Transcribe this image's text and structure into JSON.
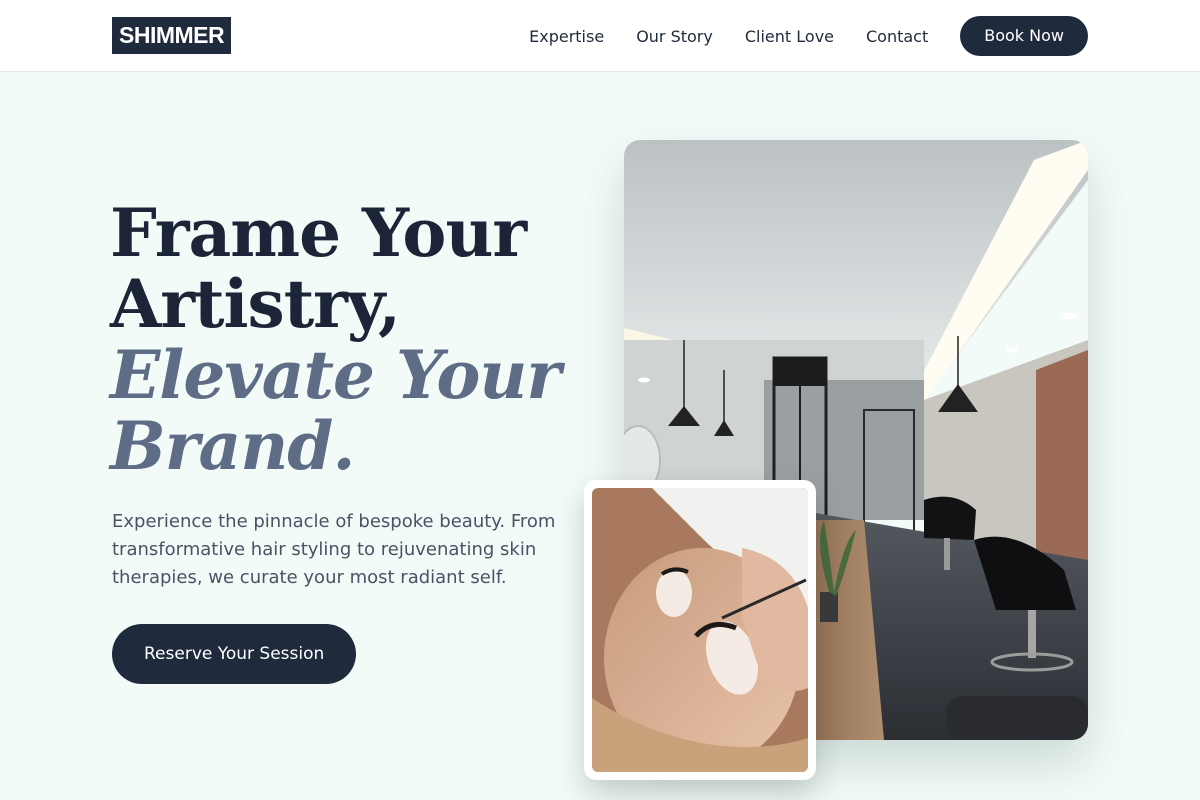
{
  "header": {
    "logo": "SHIMMER",
    "nav": [
      "Expertise",
      "Our Story",
      "Client Love",
      "Contact"
    ],
    "book_label": "Book Now"
  },
  "hero": {
    "title_line1": "Frame Your",
    "title_line2": "Artistry,",
    "title_accent1": "Elevate Your",
    "title_accent2": "Brand.",
    "description": "Experience the pinnacle of bespoke beauty. From transformative hair styling to rejuvenating skin therapies, we curate your most radiant self.",
    "cta_label": "Reserve Your Session"
  },
  "images": {
    "salon": "salon-interior-photo",
    "lash": "lash-treatment-photo"
  },
  "colors": {
    "navy": "#1f2a3c",
    "accent_slate": "#5f6c86",
    "background": "#f2fbf8"
  }
}
